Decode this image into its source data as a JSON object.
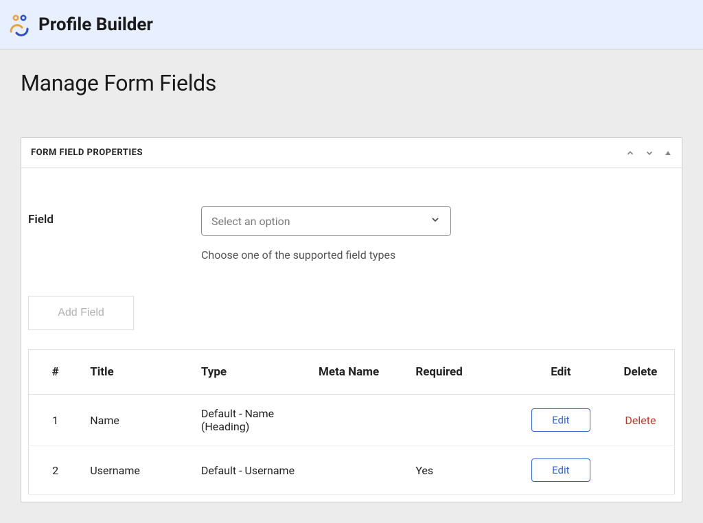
{
  "header": {
    "app_title": "Profile Builder"
  },
  "page": {
    "title": "Manage Form Fields"
  },
  "panel": {
    "header_title": "FORM FIELD PROPERTIES",
    "field_label": "Field",
    "select_placeholder": "Select an option",
    "helper_text": "Choose one of the supported field types",
    "add_field_label": "Add Field"
  },
  "table": {
    "columns": {
      "num": "#",
      "title": "Title",
      "type": "Type",
      "meta": "Meta Name",
      "required": "Required",
      "edit": "Edit",
      "delete": "Delete"
    },
    "rows": [
      {
        "num": "1",
        "title": "Name",
        "type": "Default - Name (Heading)",
        "meta": "",
        "required": "",
        "edit_label": "Edit",
        "delete_label": "Delete",
        "show_delete": true
      },
      {
        "num": "2",
        "title": "Username",
        "type": "Default - Username",
        "meta": "",
        "required": "Yes",
        "edit_label": "Edit",
        "delete_label": "",
        "show_delete": false
      }
    ]
  }
}
